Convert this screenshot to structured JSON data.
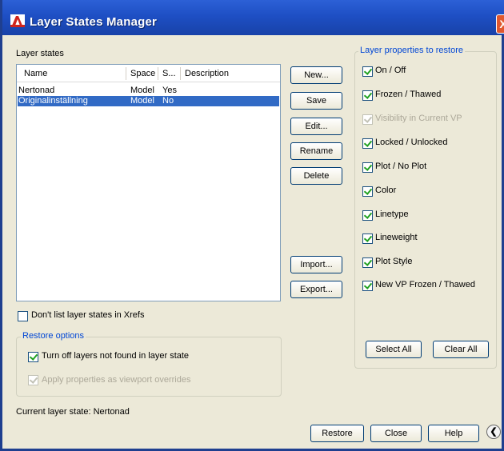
{
  "window": {
    "title": "Layer States Manager",
    "close_glyph": "X"
  },
  "layer_states": {
    "label": "Layer states",
    "columns": [
      "Name",
      "Space",
      "S...",
      "Description"
    ],
    "rows": [
      {
        "name": "Nertonad",
        "space": "Model",
        "saved": "Yes",
        "description": "",
        "selected": false
      },
      {
        "name": "Originalinställning",
        "space": "Model",
        "saved": "No",
        "description": "",
        "selected": true
      }
    ]
  },
  "buttons": {
    "new": "New...",
    "save": "Save",
    "edit": "Edit...",
    "rename": "Rename",
    "delete": "Delete",
    "import": "Import...",
    "export": "Export...",
    "select_all": "Select All",
    "clear_all": "Clear All",
    "restore": "Restore",
    "close": "Close",
    "help": "Help"
  },
  "dont_list_xrefs": {
    "label": "Don't list layer states in Xrefs",
    "checked": false
  },
  "restore_options": {
    "title": "Restore options",
    "turn_off": {
      "label": "Turn off layers not found in layer state",
      "checked": true
    },
    "apply_overrides": {
      "label": "Apply properties as viewport overrides",
      "checked": true,
      "disabled": true
    }
  },
  "properties": {
    "title": "Layer properties to restore",
    "items": [
      {
        "label": "On / Off",
        "checked": true,
        "disabled": false
      },
      {
        "label": "Frozen / Thawed",
        "checked": true,
        "disabled": false
      },
      {
        "label": "Visibility in Current VP",
        "checked": true,
        "disabled": true
      },
      {
        "label": "Locked / Unlocked",
        "checked": true,
        "disabled": false
      },
      {
        "label": "Plot / No Plot",
        "checked": true,
        "disabled": false
      },
      {
        "label": "Color",
        "checked": true,
        "disabled": false
      },
      {
        "label": "Linetype",
        "checked": true,
        "disabled": false
      },
      {
        "label": "Lineweight",
        "checked": true,
        "disabled": false
      },
      {
        "label": "Plot Style",
        "checked": true,
        "disabled": false
      },
      {
        "label": "New VP Frozen / Thawed",
        "checked": true,
        "disabled": false
      }
    ]
  },
  "status": {
    "current_state": "Current layer state: Nertonad"
  },
  "icons": {
    "app": "autocad-app-icon",
    "collapse": "chevron-left-icon",
    "collapse_glyph": "❮"
  },
  "colors": {
    "titlebar": "#1e4fc4",
    "selection": "#316ac5",
    "group_title": "#0046d5",
    "close": "#e0572f"
  }
}
